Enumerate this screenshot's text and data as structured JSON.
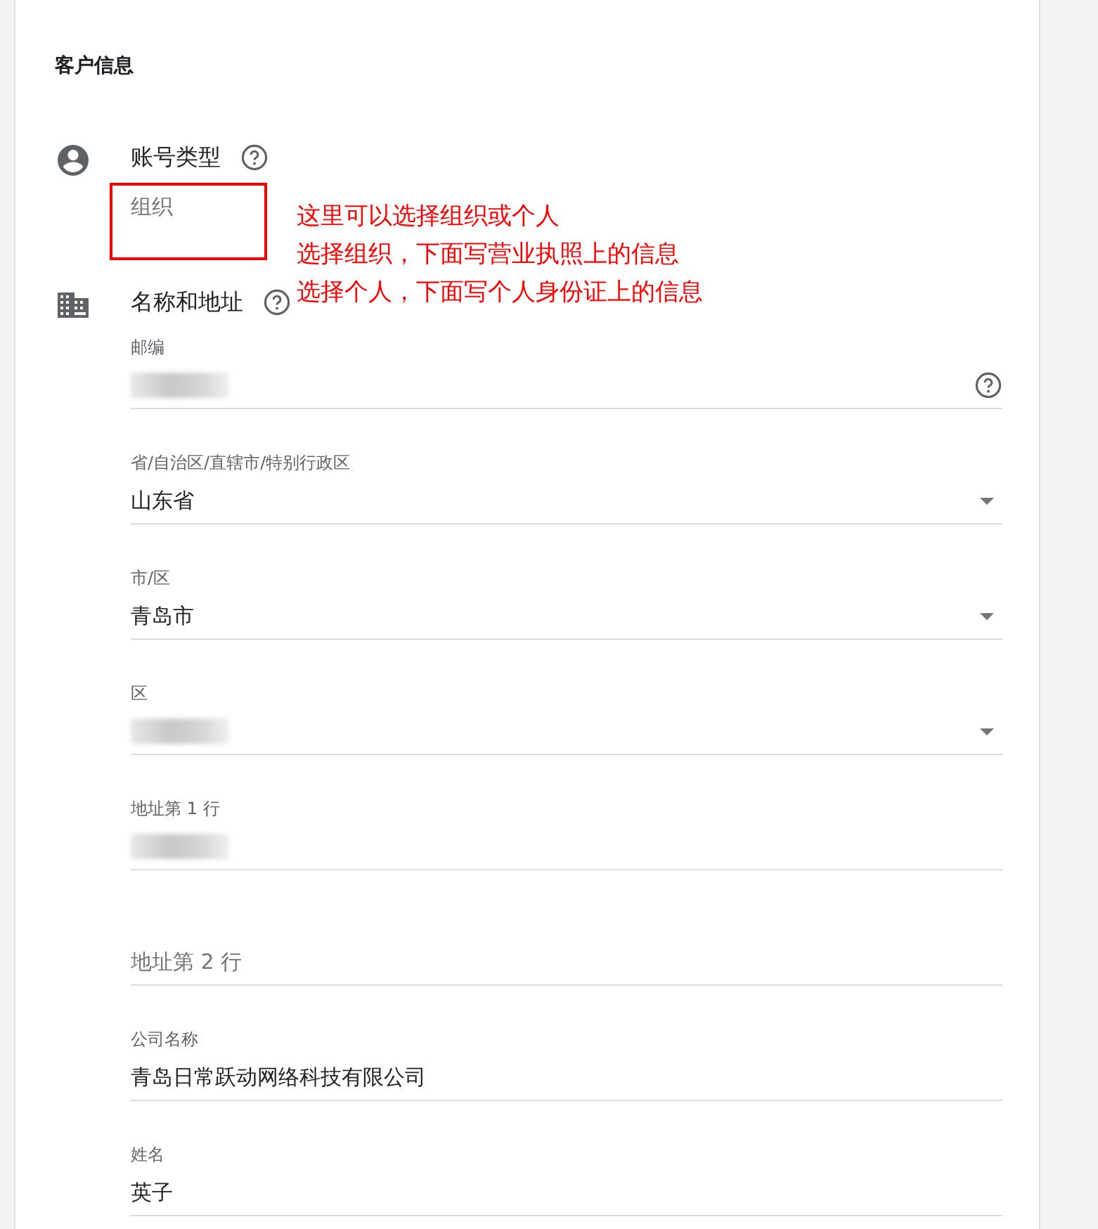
{
  "section_title": "客户信息",
  "account_type": {
    "title": "账号类型",
    "help": true,
    "value": "组织"
  },
  "name_address": {
    "title": "名称和地址",
    "help": true,
    "fields": [
      {
        "kind": "text",
        "label": "邮编",
        "blurred": true,
        "help": true
      },
      {
        "kind": "select",
        "label": "省/自治区/直辖市/特别行政区",
        "value": "山东省"
      },
      {
        "kind": "select",
        "label": "市/区",
        "value": "青岛市"
      },
      {
        "kind": "select",
        "label": "区",
        "blurred": true
      },
      {
        "kind": "text",
        "label": "地址第 1 行",
        "blurred": true
      },
      {
        "kind": "text",
        "placeholder": "地址第 2 行"
      },
      {
        "kind": "text",
        "label": "公司名称",
        "value": "青岛日常跃动网络科技有限公司"
      },
      {
        "kind": "text",
        "label": "姓名",
        "value": "英子"
      }
    ]
  },
  "annotation": {
    "lines": [
      "这里可以选择组织或个人",
      "选择组织，下面写营业执照上的信息",
      "选择个人，下面写个人身份证上的信息"
    ]
  }
}
